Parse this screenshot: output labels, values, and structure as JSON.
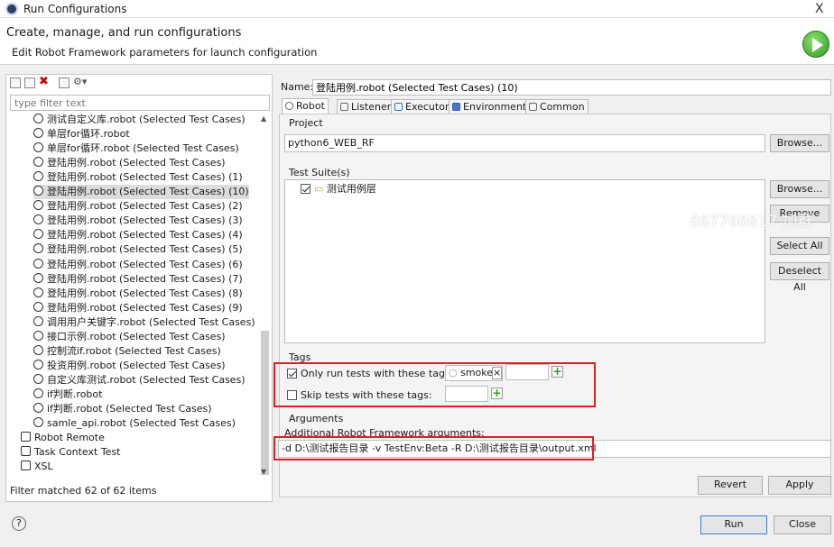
{
  "window": {
    "title": "Run Configurations",
    "close": "X"
  },
  "header": {
    "title": "Create, manage, and run configurations",
    "subtitle": "Edit Robot Framework parameters for launch configuration"
  },
  "left": {
    "filter_placeholder": "type filter text",
    "items": [
      {
        "label": "测试自定义库.robot (Selected Test Cases)",
        "icon": "robot-icon"
      },
      {
        "label": "单层for循环.robot",
        "icon": "robot-icon"
      },
      {
        "label": "单层for循环.robot (Selected Test Cases)",
        "icon": "robot-icon"
      },
      {
        "label": "登陆用例.robot (Selected Test Cases)",
        "icon": "robot-icon"
      },
      {
        "label": "登陆用例.robot (Selected Test Cases) (1)",
        "icon": "robot-icon"
      },
      {
        "label": "登陆用例.robot (Selected Test Cases) (10)",
        "icon": "robot-icon",
        "selected": true
      },
      {
        "label": "登陆用例.robot (Selected Test Cases) (2)",
        "icon": "robot-icon"
      },
      {
        "label": "登陆用例.robot (Selected Test Cases) (3)",
        "icon": "robot-icon"
      },
      {
        "label": "登陆用例.robot (Selected Test Cases) (4)",
        "icon": "robot-icon"
      },
      {
        "label": "登陆用例.robot (Selected Test Cases) (5)",
        "icon": "robot-icon"
      },
      {
        "label": "登陆用例.robot (Selected Test Cases) (6)",
        "icon": "robot-icon"
      },
      {
        "label": "登陆用例.robot (Selected Test Cases) (7)",
        "icon": "robot-icon"
      },
      {
        "label": "登陆用例.robot (Selected Test Cases) (8)",
        "icon": "robot-icon"
      },
      {
        "label": "登陆用例.robot (Selected Test Cases) (9)",
        "icon": "robot-icon"
      },
      {
        "label": "调用用户关键字.robot (Selected Test Cases)",
        "icon": "robot-icon"
      },
      {
        "label": "接口示例.robot (Selected Test Cases)",
        "icon": "robot-icon"
      },
      {
        "label": "控制流if.robot (Selected Test Cases)",
        "icon": "robot-icon"
      },
      {
        "label": "投资用例.robot (Selected Test Cases)",
        "icon": "robot-icon"
      },
      {
        "label": "自定义库测试.robot (Selected Test Cases)",
        "icon": "robot-icon"
      },
      {
        "label": "if判断.robot",
        "icon": "robot-icon"
      },
      {
        "label": "if判断.robot (Selected Test Cases)",
        "icon": "robot-icon"
      },
      {
        "label": "samle_api.robot (Selected Test Cases)",
        "icon": "robot-icon"
      }
    ],
    "categories": [
      {
        "label": "Robot Remote",
        "icon": "robot-remote-icon"
      },
      {
        "label": "Task Context Test",
        "icon": "task-context-icon"
      },
      {
        "label": "XSL",
        "icon": "xsl-icon"
      }
    ],
    "status": "Filter matched 62 of 62 items"
  },
  "config": {
    "name_label": "Name:",
    "name_value": "登陆用例.robot (Selected Test Cases) (10)",
    "tabs": [
      "Robot",
      "Listener",
      "Executor",
      "Environment",
      "Common"
    ],
    "project": {
      "label": "Project",
      "value": "python6_WEB_RF",
      "browse": "Browse..."
    },
    "suite": {
      "label": "Test Suite(s)",
      "item": "测试用例层",
      "browse": "Browse...",
      "remove": "Remove",
      "select_all": "Select All",
      "deselect_all": "Deselect All"
    },
    "tags": {
      "label": "Tags",
      "only_run": "Only run tests with these tags:",
      "tag": "smoke",
      "tag_remove": "×",
      "skip": "Skip tests with these tags:"
    },
    "args": {
      "label": "Arguments",
      "sublabel": "Additional Robot Framework arguments:",
      "value": "-d D:\\测试报告目录 -v TestEnv:Beta -R D:\\测试报告目录\\output.xml"
    },
    "revert": "Revert",
    "apply": "Apply"
  },
  "footer": {
    "help": "?",
    "run": "Run",
    "close": "Close"
  },
  "watermark": "867766817 加群",
  "colors": {
    "highlight": "#e02020",
    "accent": "#2f9a27"
  }
}
